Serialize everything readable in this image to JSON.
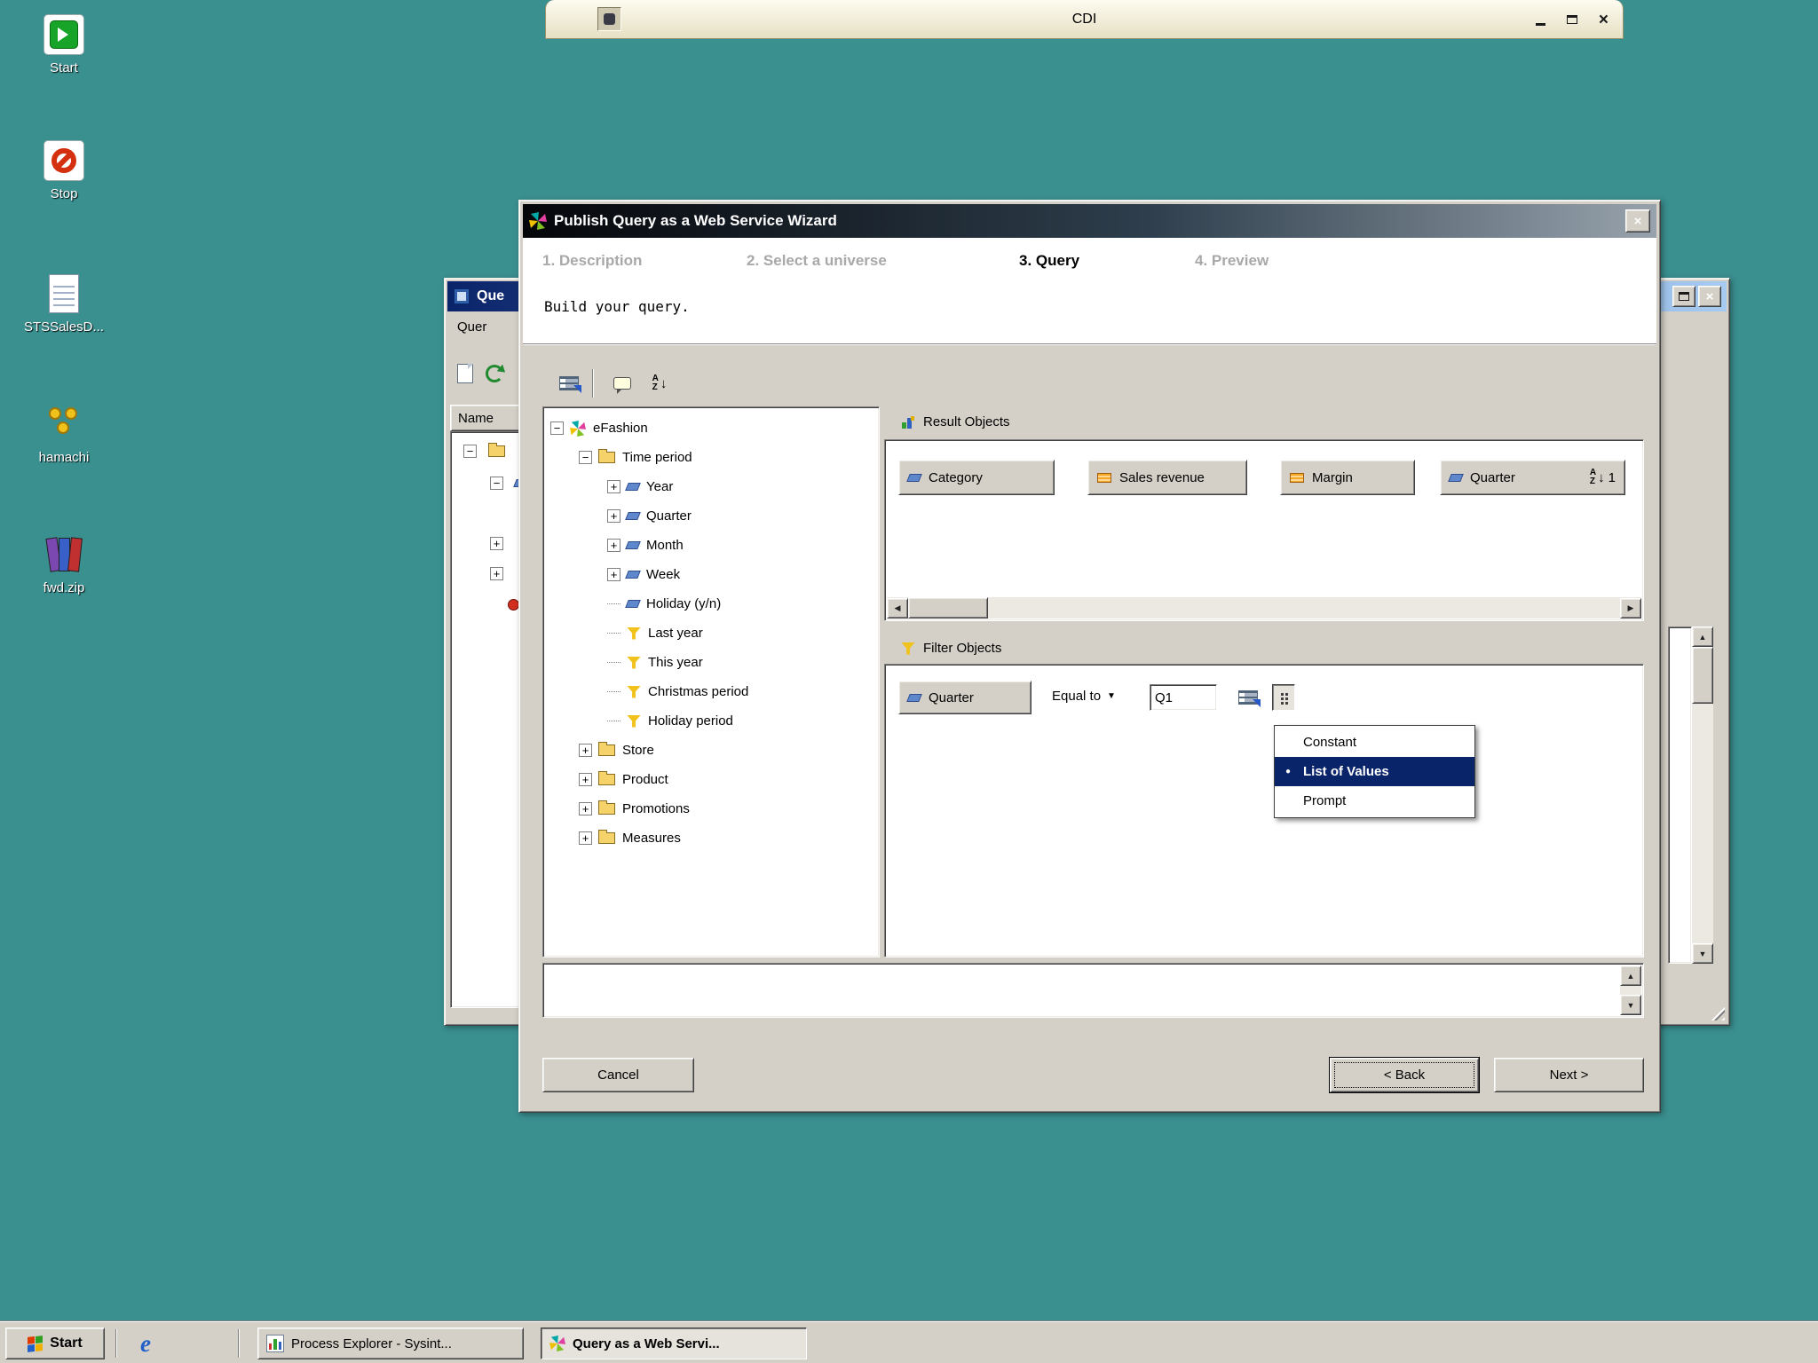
{
  "colors": {
    "desktop_background": "#3A8F8F",
    "selection_navy": "#0A246A",
    "dimension_blue": "#5F87CC",
    "measure_orange": "#F5A623",
    "filter_gold": "#F2C21C",
    "window_face": "#D4D0C8"
  },
  "desktop": {
    "icons": [
      {
        "label": "Start",
        "icon": "start-arrow"
      },
      {
        "label": "Stop",
        "icon": "stop-sign"
      },
      {
        "label": "STSSalesD...",
        "icon": "document"
      },
      {
        "label": "hamachi",
        "icon": "hamachi-dots"
      },
      {
        "label": "fwd.zip",
        "icon": "winrar-books"
      }
    ]
  },
  "cdi_window": {
    "title": "CDI"
  },
  "app_window": {
    "title": "Que",
    "menu": "Quer",
    "name_header": "Name"
  },
  "wizard": {
    "title": "Publish Query as a Web Service Wizard",
    "steps": [
      {
        "label": "1. Description",
        "active": false
      },
      {
        "label": "2. Select a universe",
        "active": false
      },
      {
        "label": "3. Query",
        "active": true
      },
      {
        "label": "4. Preview",
        "active": false
      }
    ],
    "subtitle": "Build your query.",
    "universe_tree": [
      {
        "label": "eFashion",
        "type": "universe",
        "expander": "minus"
      },
      {
        "label": "Time period",
        "type": "folder",
        "expander": "minus"
      },
      {
        "label": "Year",
        "type": "dimension",
        "expander": "plus"
      },
      {
        "label": "Quarter",
        "type": "dimension",
        "expander": "plus"
      },
      {
        "label": "Month",
        "type": "dimension",
        "expander": "plus"
      },
      {
        "label": "Week",
        "type": "dimension",
        "expander": "plus"
      },
      {
        "label": "Holiday (y/n)",
        "type": "dimension",
        "expander": "none"
      },
      {
        "label": "Last year",
        "type": "filter",
        "expander": "none"
      },
      {
        "label": "This year",
        "type": "filter",
        "expander": "none"
      },
      {
        "label": "Christmas period",
        "type": "filter",
        "expander": "none"
      },
      {
        "label": "Holiday period",
        "type": "filter",
        "expander": "none"
      },
      {
        "label": "Store",
        "type": "folder",
        "expander": "plus"
      },
      {
        "label": "Product",
        "type": "folder",
        "expander": "plus"
      },
      {
        "label": "Promotions",
        "type": "folder",
        "expander": "plus"
      },
      {
        "label": "Measures",
        "type": "folder",
        "expander": "plus"
      }
    ],
    "result_objects": {
      "header": "Result Objects",
      "items": [
        {
          "label": "Category",
          "type": "dimension"
        },
        {
          "label": "Sales revenue",
          "type": "measure"
        },
        {
          "label": "Margin",
          "type": "measure"
        },
        {
          "label": "Quarter",
          "type": "dimension",
          "sort_order": "1"
        }
      ]
    },
    "filter_objects": {
      "header": "Filter Objects",
      "object": "Quarter",
      "operator": "Equal to",
      "value": "Q1",
      "menu": [
        {
          "label": "Constant",
          "selected": false
        },
        {
          "label": "List of Values",
          "selected": true
        },
        {
          "label": "Prompt",
          "selected": false
        }
      ]
    },
    "buttons": {
      "cancel": "Cancel",
      "back": "< Back",
      "next": "Next >"
    }
  },
  "taskbar": {
    "start": "Start",
    "tasks": [
      {
        "label": "Process Explorer - Sysint...",
        "active": false
      },
      {
        "label": "Query as a Web Servi...",
        "active": true
      }
    ]
  }
}
